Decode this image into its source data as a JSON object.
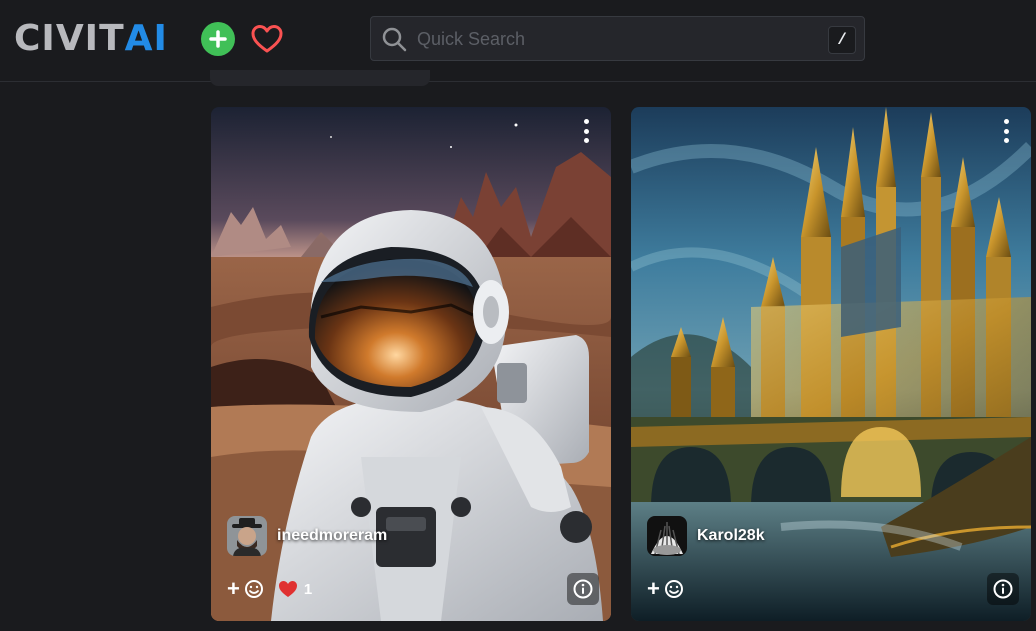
{
  "header": {
    "logo_part1": "CIVIT",
    "logo_part2": "AI",
    "add_icon": "plus-circle-icon",
    "heart_icon": "heart-outline-icon",
    "brand_colors": {
      "gray": "#b8b9bd",
      "blue": "#228be6",
      "green": "#40c057",
      "heart": "#fa5252"
    }
  },
  "search": {
    "placeholder": "Quick Search",
    "shortcut": "/"
  },
  "cards": [
    {
      "username": "ineedmoreram",
      "reaction_add": "+",
      "heart_count": "1",
      "subject": "astronaut in desert"
    },
    {
      "username": "Karol28k",
      "reaction_add": "+",
      "heart_count": "",
      "subject": "golden castle"
    }
  ]
}
